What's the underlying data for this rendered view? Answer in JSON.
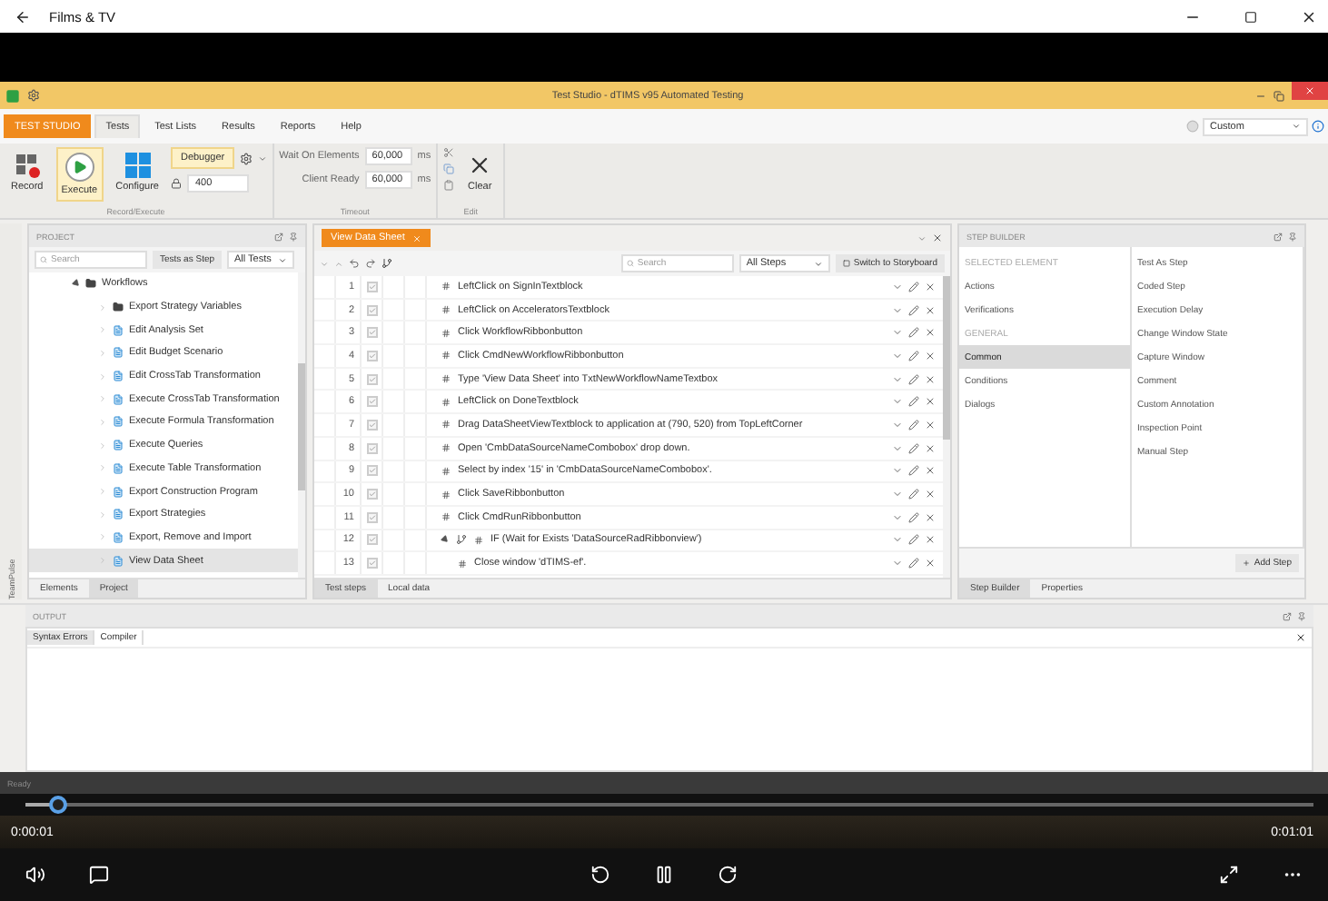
{
  "app": {
    "title": "Films & TV"
  },
  "video": {
    "window_title": "Test Studio - dTIMS v95 Automated Testing",
    "ribbon_tabs": [
      {
        "label": "TEST STUDIO",
        "kind": "app",
        "selected": false
      },
      {
        "label": "Tests",
        "kind": "tab",
        "selected": true
      },
      {
        "label": "Test Lists",
        "kind": "tab",
        "selected": false
      },
      {
        "label": "Results",
        "kind": "tab",
        "selected": false
      },
      {
        "label": "Reports",
        "kind": "tab",
        "selected": false
      },
      {
        "label": "Help",
        "kind": "tab",
        "selected": false
      }
    ],
    "theme_select": "Custom",
    "ribbon": {
      "record": "Record",
      "execute": "Execute",
      "configure": "Configure",
      "debugger": "Debugger",
      "delay": "400",
      "group_1": "Record/Execute",
      "timeouts": [
        {
          "label": "Wait On Elements",
          "value": "60,000",
          "unit": "ms"
        },
        {
          "label": "Client Ready",
          "value": "60,000",
          "unit": "ms"
        }
      ],
      "group_2": "Timeout",
      "clear": "Clear",
      "group_3": "Edit"
    },
    "side_strip": "TeamPulse",
    "project": {
      "title": "PROJECT",
      "search_placeholder": "Search",
      "tests_as_step": "Tests as Step",
      "filter": "All Tests",
      "tree": [
        {
          "label": "Workflows",
          "kind": "folder",
          "expanded": true,
          "selected": false,
          "children": [
            {
              "label": "Export Strategy Variables",
              "kind": "folder",
              "expanded": false,
              "selected": false
            },
            {
              "label": "Edit Analysis Set",
              "kind": "test",
              "expanded": false,
              "selected": false
            },
            {
              "label": "Edit Budget Scenario",
              "kind": "test",
              "expanded": false,
              "selected": false
            },
            {
              "label": "Edit CrossTab Transformation",
              "kind": "test",
              "expanded": false,
              "selected": false
            },
            {
              "label": "Execute CrossTab Transformation",
              "kind": "test",
              "expanded": false,
              "selected": false
            },
            {
              "label": "Execute Formula Transformation",
              "kind": "test",
              "expanded": false,
              "selected": false
            },
            {
              "label": "Execute Queries",
              "kind": "test",
              "expanded": false,
              "selected": false
            },
            {
              "label": "Execute Table Transformation",
              "kind": "test",
              "expanded": false,
              "selected": false
            },
            {
              "label": "Export Construction Program",
              "kind": "test",
              "expanded": false,
              "selected": false
            },
            {
              "label": "Export Strategies",
              "kind": "test",
              "expanded": false,
              "selected": false
            },
            {
              "label": "Export, Remove and Import",
              "kind": "test",
              "expanded": false,
              "selected": false
            },
            {
              "label": "View Data Sheet",
              "kind": "test",
              "expanded": false,
              "selected": true
            }
          ]
        }
      ],
      "tabs": [
        {
          "label": "Elements",
          "selected": false
        },
        {
          "label": "Project",
          "selected": true
        }
      ]
    },
    "steps": {
      "doc_tab": "View Data Sheet",
      "search_placeholder": "Search",
      "filter": "All Steps",
      "storyboard": "Switch to Storyboard",
      "rows": [
        {
          "number": "1",
          "checked": true,
          "kind": "step",
          "text": "LeftClick on SignInTextblock"
        },
        {
          "number": "2",
          "checked": true,
          "kind": "step",
          "text": "LeftClick on AcceleratorsTextblock"
        },
        {
          "number": "3",
          "checked": true,
          "kind": "step",
          "text": "Click WorkflowRibbonbutton"
        },
        {
          "number": "4",
          "checked": true,
          "kind": "step",
          "text": "Click CmdNewWorkflowRibbonbutton"
        },
        {
          "number": "5",
          "checked": true,
          "kind": "step",
          "text": "Type 'View Data Sheet' into TxtNewWorkflowNameTextbox"
        },
        {
          "number": "6",
          "checked": true,
          "kind": "step",
          "text": "LeftClick on DoneTextblock"
        },
        {
          "number": "7",
          "checked": true,
          "kind": "step",
          "text": "Drag DataSheetViewTextblock to application at (790, 520) from TopLeftCorner"
        },
        {
          "number": "8",
          "checked": true,
          "kind": "step",
          "text": "Open 'CmbDataSourceNameCombobox' drop down."
        },
        {
          "number": "9",
          "checked": true,
          "kind": "step",
          "text": "Select by index '15' in 'CmbDataSourceNameCombobox'."
        },
        {
          "number": "10",
          "checked": true,
          "kind": "step",
          "text": "Click SaveRibbonbutton"
        },
        {
          "number": "11",
          "checked": true,
          "kind": "step",
          "text": "Click CmdRunRibbonbutton"
        },
        {
          "number": "12",
          "checked": true,
          "kind": "if",
          "expanded": true,
          "text": "IF (Wait for Exists 'DataSourceRadRibbonview')",
          "children": [
            {
              "number": "13",
              "checked": true,
              "kind": "step",
              "text": "Close window 'dTIMS-ef'."
            }
          ]
        }
      ],
      "tabs": [
        {
          "label": "Test steps",
          "selected": true
        },
        {
          "label": "Local data",
          "selected": false
        }
      ]
    },
    "step_builder": {
      "title": "STEP BUILDER",
      "categories": [
        {
          "label": "SELECTED ELEMENT",
          "kind": "header"
        },
        {
          "label": "Actions",
          "kind": "item",
          "selected": false
        },
        {
          "label": "Verifications",
          "kind": "item",
          "selected": false
        },
        {
          "label": "GENERAL",
          "kind": "header"
        },
        {
          "label": "Common",
          "kind": "item",
          "selected": true
        },
        {
          "label": "Conditions",
          "kind": "item",
          "selected": false
        },
        {
          "label": "Dialogs",
          "kind": "item",
          "selected": false
        }
      ],
      "options": [
        "Test As Step",
        "Coded Step",
        "Execution Delay",
        "Change Window State",
        "Capture Window",
        "Comment",
        "Custom Annotation",
        "Inspection Point",
        "Manual Step"
      ],
      "add_step": "Add Step",
      "tabs": [
        {
          "label": "Step Builder",
          "selected": true
        },
        {
          "label": "Properties",
          "selected": false
        }
      ]
    },
    "output": {
      "title": "OUTPUT",
      "tabs": [
        {
          "label": "Syntax Errors",
          "selected": true
        },
        {
          "label": "Compiler",
          "selected": false
        }
      ]
    },
    "status": "Ready"
  },
  "player": {
    "position": "0:00:01",
    "duration": "0:01:01",
    "level": 0.025,
    "playing": true
  }
}
